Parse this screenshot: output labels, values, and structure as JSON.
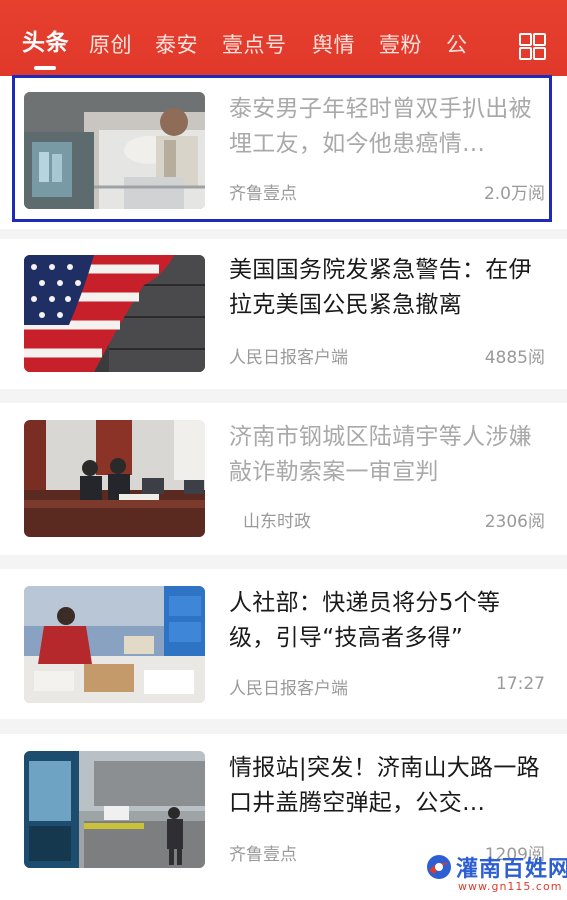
{
  "tabs": {
    "items": [
      {
        "label": "头条",
        "active": true
      },
      {
        "label": "原创",
        "active": false
      },
      {
        "label": "泰安",
        "active": false
      },
      {
        "label": "壹点号",
        "active": false
      },
      {
        "label": "舆情",
        "active": false
      },
      {
        "label": "壹粉",
        "active": false
      },
      {
        "label": "公",
        "active": false
      }
    ],
    "more_icon": "grid-menu-icon"
  },
  "colors": {
    "header_red": "#e23c2d",
    "highlight_blue": "#1e2bb8",
    "read_title": "#a9a9a9",
    "unread_title": "#1a1a1a"
  },
  "feed": {
    "articles": [
      {
        "title": "泰安男子年轻时曾双手扒出被埋工友，如今他患癌情…",
        "source": "齐鲁壹点",
        "meta": "2.0万阅",
        "read": true,
        "image": "patient-in-hospital-bed",
        "highlighted": true
      },
      {
        "title": "美国国务院发紧急警告：在伊拉克美国公民紧急撤离",
        "source": "人民日报客户端",
        "meta": "4885阅",
        "read": false,
        "image": "american-flag-on-wood"
      },
      {
        "title": "济南市钢城区陆靖宇等人涉嫌敲诈勒索案一审宣判",
        "source": "山东时政",
        "meta": "2306阅",
        "read": true,
        "image": "courtroom-judges"
      },
      {
        "title": "人社部：快递员将分5个等级，引导“技高者多得”",
        "source": "人民日报客户端",
        "meta": "17:27",
        "read": false,
        "image": "courier-sorting-parcels"
      },
      {
        "title": "情报站|突发！济南山大路一路口井盖腾空弹起，公交…",
        "source": "齐鲁壹点",
        "meta": "1209阅",
        "read": false,
        "image": "bus-at-intersection"
      }
    ]
  },
  "watermark": {
    "name": "灌南百姓网",
    "url": "www.gn115.com"
  }
}
